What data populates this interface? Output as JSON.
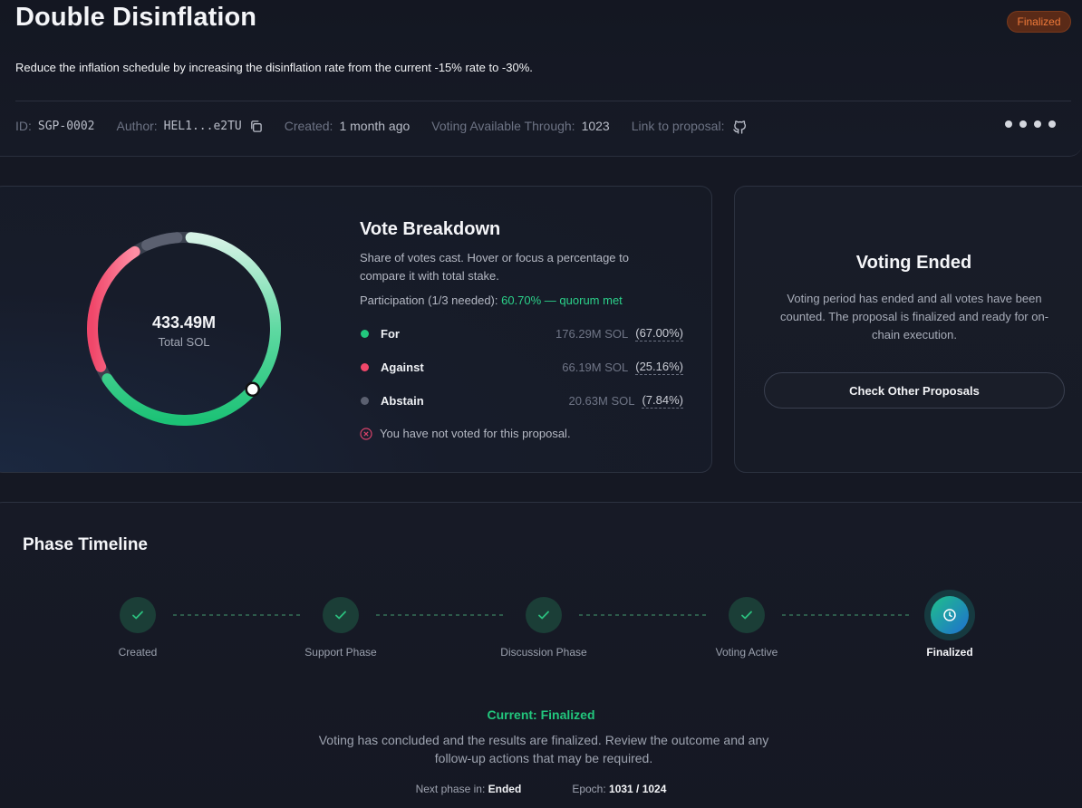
{
  "proposal": {
    "title": "Double Disinflation",
    "status": "Finalized",
    "description": "Reduce the inflation schedule by increasing the disinflation rate from the current -15% rate to -30%."
  },
  "meta": {
    "id_label": "ID:",
    "id_value": "SGP-0002",
    "author_label": "Author:",
    "author_value": "HEL1...e2TU",
    "created_label": "Created:",
    "created_value": "1 month ago",
    "voting_label": "Voting Available Through:",
    "voting_value": "1023",
    "link_label": "Link to proposal:",
    "copy_icon": "copy-icon",
    "link_icon": "github-icon",
    "more_icon": "more-dots-icon"
  },
  "donut": {
    "total": "433.49M",
    "total_label": "Total SOL"
  },
  "breakdown": {
    "title": "Vote Breakdown",
    "description": "Share of votes cast. Hover or focus a percentage to compare it with total stake.",
    "participation_label": "Participation (1/3 needed):",
    "participation_value": "60.70% — quorum met",
    "votes": [
      {
        "label": "For",
        "amount": "176.29M SOL",
        "percent": "(67.00%)",
        "share": 0.67,
        "color": "#22c77d"
      },
      {
        "label": "Against",
        "amount": "66.19M SOL",
        "percent": "(25.16%)",
        "share": 0.2516,
        "color": "#f0476a"
      },
      {
        "label": "Abstain",
        "amount": "20.63M SOL",
        "percent": "(7.84%)",
        "share": 0.0784,
        "color": "#5b6070"
      }
    ],
    "not_voted": "You have not voted for this proposal."
  },
  "ended": {
    "title": "Voting Ended",
    "description": "Voting period has ended and all votes have been counted. The proposal is finalized and ready for on-chain execution.",
    "button": "Check Other Proposals"
  },
  "timeline": {
    "title": "Phase Timeline",
    "steps": [
      {
        "label": "Created",
        "state": "complete"
      },
      {
        "label": "Support Phase",
        "state": "complete"
      },
      {
        "label": "Discussion Phase",
        "state": "complete"
      },
      {
        "label": "Voting Active",
        "state": "complete"
      },
      {
        "label": "Finalized",
        "state": "current"
      }
    ],
    "current_label": "Current: Finalized",
    "current_description": "Voting has concluded and the results are finalized. Review the outcome and any follow-up actions that may be required.",
    "next_phase_label": "Next phase in:",
    "next_phase_value": "Ended",
    "epoch_label": "Epoch:",
    "epoch_value": "1031 / 1024"
  },
  "colors": {
    "accent_green": "#22c77d",
    "against_red": "#f0476a",
    "abstain_gray": "#5b6070",
    "status_orange": "#f07a3a"
  }
}
